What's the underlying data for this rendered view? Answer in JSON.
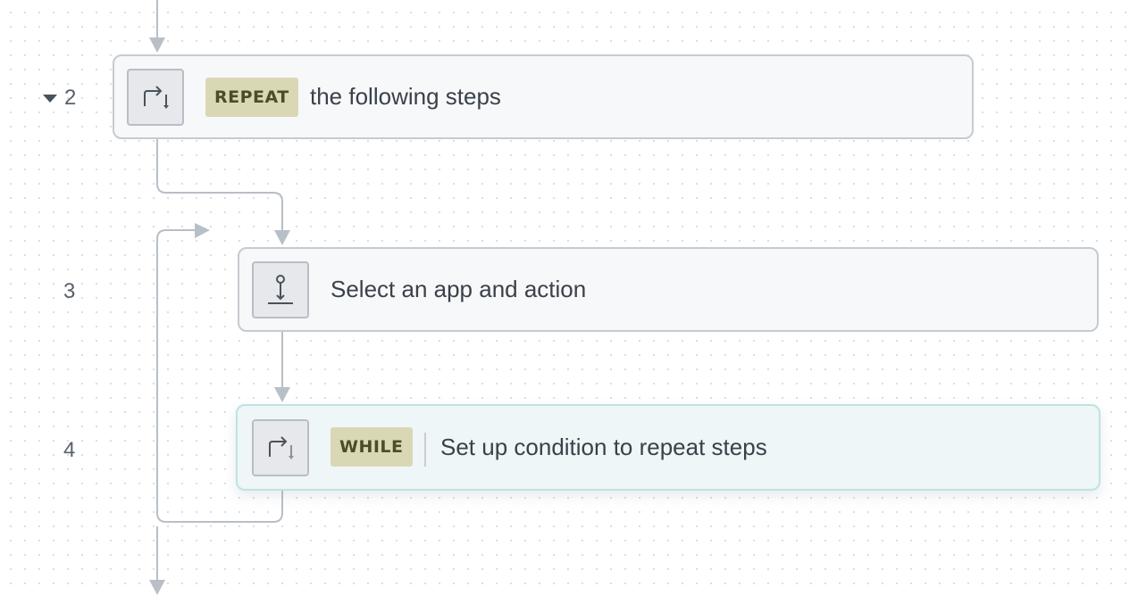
{
  "steps": [
    {
      "number": "2",
      "collapsible": true,
      "icon": "repeat-icon",
      "badge": "REPEAT",
      "text": "the following steps"
    },
    {
      "number": "3",
      "collapsible": false,
      "icon": "action-placeholder-icon",
      "badge": "",
      "text": "Select an app and action"
    },
    {
      "number": "4",
      "collapsible": false,
      "icon": "repeat-icon",
      "badge": "WHILE",
      "text": "Set up condition to repeat steps",
      "selected": true
    }
  ],
  "colors": {
    "connector": "#b8bfc6",
    "badge_bg": "#dad7b5",
    "badge_text": "#4b4d26",
    "selected_border": "#bfe2e3",
    "selected_bg": "#eef6f7"
  }
}
